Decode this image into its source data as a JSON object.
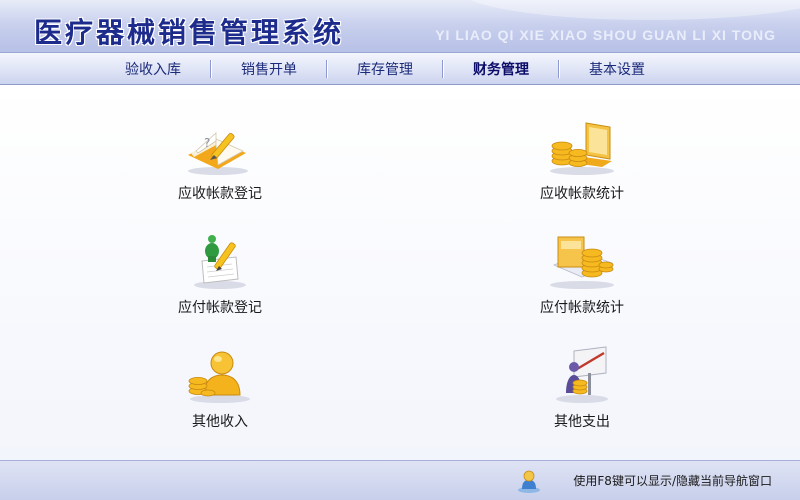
{
  "header": {
    "title": "医疗器械销售管理系统",
    "pinyin": "YI LIAO QI XIE XIAO SHOU GUAN LI XI TONG"
  },
  "nav": {
    "items": [
      {
        "label": "验收入库"
      },
      {
        "label": "销售开单"
      },
      {
        "label": "库存管理"
      },
      {
        "label": "财务管理"
      },
      {
        "label": "基本设置"
      }
    ],
    "active": "财务管理"
  },
  "main": {
    "tiles": [
      {
        "label": "应收帐款登记",
        "icon": "notebook-pencil-icon"
      },
      {
        "label": "应收帐款统计",
        "icon": "coins-laptop-icon"
      },
      {
        "label": "应付帐款登记",
        "icon": "note-figure-pencil-icon"
      },
      {
        "label": "应付帐款统计",
        "icon": "coins-card-icon"
      },
      {
        "label": "其他收入",
        "icon": "person-coins-icon"
      },
      {
        "label": "其他支出",
        "icon": "person-chart-icon"
      }
    ]
  },
  "footer": {
    "hint": "使用F8键可以显示/隐藏当前导航窗口",
    "icon": "user-icon"
  },
  "colors": {
    "title": "#1d2c8c",
    "nav_text": "#1b2a7a",
    "header_bg": "#c9d1ee",
    "coin": "#f2b21b"
  }
}
